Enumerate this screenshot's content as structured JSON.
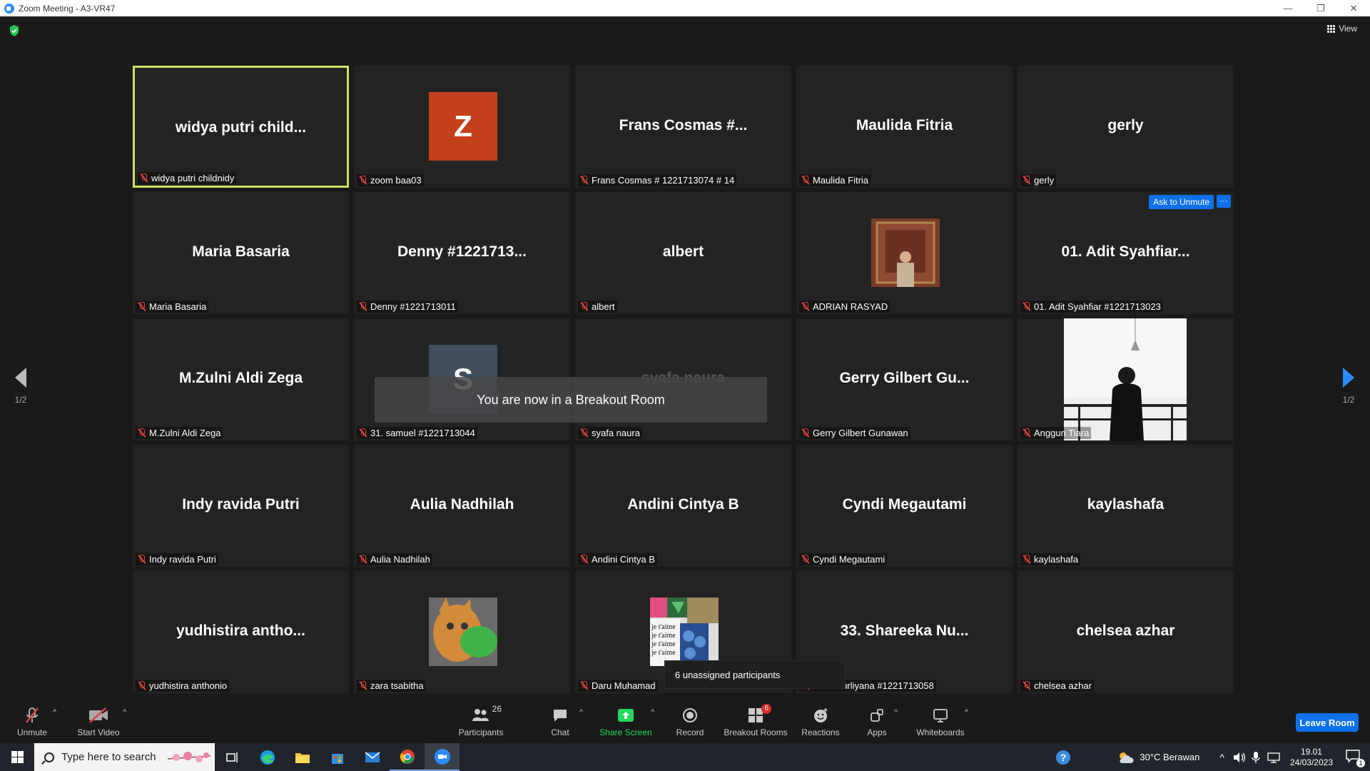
{
  "window": {
    "title": "Zoom Meeting - A3-VR47",
    "controls": [
      "—",
      "❐",
      "✕"
    ]
  },
  "view_label": "View",
  "pager": {
    "left": "1/2",
    "right": "1/2"
  },
  "tiles": [
    {
      "big": "widya putri child...",
      "label": "widya putri childnidy",
      "active": true
    },
    {
      "big": "",
      "label": "zoom baa03",
      "avatar": "Z",
      "avatar_color": "#c4401a"
    },
    {
      "big": "Frans Cosmas #...",
      "label": "Frans Cosmas # 1221713074 # 14"
    },
    {
      "big": "Maulida Fitria",
      "label": "Maulida Fitria"
    },
    {
      "big": "gerly",
      "label": "gerly"
    },
    {
      "big": "Maria Basaria",
      "label": "Maria Basaria"
    },
    {
      "big": "Denny #1221713...",
      "label": "Denny #1221713011"
    },
    {
      "big": "albert",
      "label": "albert"
    },
    {
      "big": "",
      "label": "ADRIAN RASYAD",
      "photo": "adrian"
    },
    {
      "big": "01. Adit Syahfiar...",
      "label": "01. Adit Syahfiar #1221713023",
      "ask_unmute": "Ask to Unmute",
      "more": "···"
    },
    {
      "big": "M.Zulni Aldi Zega",
      "label": "M.Zulni Aldi Zega"
    },
    {
      "big": "",
      "label": "31. samuel #1221713044",
      "avatar": "S",
      "avatar_color": "#3f4d5c"
    },
    {
      "big": "syafa naura",
      "label": "syafa naura",
      "dim": true
    },
    {
      "big": "Gerry Gilbert Gu...",
      "label": "Gerry Gilbert Gunawan"
    },
    {
      "big": "",
      "label": "Anggun Tiara",
      "photo": "anggun"
    },
    {
      "big": "Indy ravida Putri",
      "label": "Indy ravida Putri"
    },
    {
      "big": "Aulia Nadhilah",
      "label": "Aulia Nadhilah"
    },
    {
      "big": "Andini Cintya B",
      "label": "Andini Cintya B"
    },
    {
      "big": "Cyndi Megautami",
      "label": "Cyndi Megautami"
    },
    {
      "big": "kaylashafa",
      "label": "kaylashafa"
    },
    {
      "big": "yudhistira antho...",
      "label": "yudhistira anthonio"
    },
    {
      "big": "",
      "label": "zara tsabitha",
      "photo": "cat"
    },
    {
      "big": "",
      "label": "Daru Muhamad",
      "photo": "collage"
    },
    {
      "big": "33. Shareeka Nu...",
      "label": "eeka Nurliyana #1221713058"
    },
    {
      "big": "chelsea azhar",
      "label": "chelsea azhar"
    }
  ],
  "toast": "You are now in a Breakout Room",
  "tooltip": "6 unassigned participants",
  "toolbar": {
    "unmute": "Unmute",
    "start_video": "Start Video",
    "participants": "Participants",
    "participants_count": "26",
    "chat": "Chat",
    "share_screen": "Share Screen",
    "record": "Record",
    "breakout_rooms": "Breakout Rooms",
    "breakout_badge": "6",
    "reactions": "Reactions",
    "apps": "Apps",
    "whiteboards": "Whiteboards",
    "leave_room": "Leave Room"
  },
  "taskbar": {
    "search_placeholder": "Type here to search",
    "weather": "30°C  Berawan",
    "time": "19.01",
    "date": "24/03/2023",
    "notification_count": "1"
  },
  "colors": {
    "accent": "#0e71eb",
    "active_speaker": "#c8e25a",
    "muted": "#e0443e",
    "share_green": "#23d959"
  }
}
